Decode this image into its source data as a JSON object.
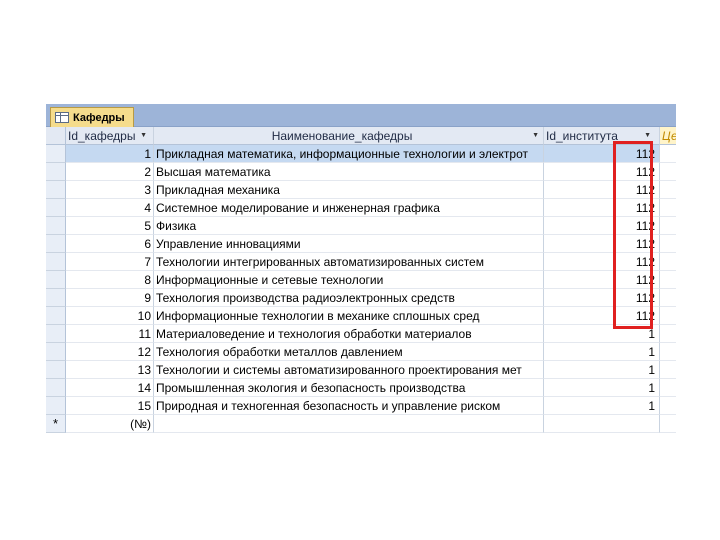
{
  "tab": {
    "label": "Кафедры",
    "icon": "table-icon"
  },
  "columns": {
    "id": "Id_кафедры",
    "name": "Наименование_кафедры",
    "inst": "Id_института",
    "extra": "Цел"
  },
  "rows": [
    {
      "id": "1",
      "name": "Прикладная математика, информационные технологии и электрот",
      "inst": "112"
    },
    {
      "id": "2",
      "name": "Высшая математика",
      "inst": "112"
    },
    {
      "id": "3",
      "name": "Прикладная механика",
      "inst": "112"
    },
    {
      "id": "4",
      "name": "Системное моделирование и инженерная графика",
      "inst": "112"
    },
    {
      "id": "5",
      "name": "Физика",
      "inst": "112"
    },
    {
      "id": "6",
      "name": "Управление инновациями",
      "inst": "112"
    },
    {
      "id": "7",
      "name": "Технологии интегрированных автоматизированных систем",
      "inst": "112"
    },
    {
      "id": "8",
      "name": "Информационные и сетевые технологии",
      "inst": "112"
    },
    {
      "id": "9",
      "name": "Технология производства радиоэлектронных средств",
      "inst": "112"
    },
    {
      "id": "10",
      "name": "Информационные технологии в механике сплошных сред",
      "inst": "112"
    },
    {
      "id": "11",
      "name": "Материаловедение и технология обработки материалов",
      "inst": "1"
    },
    {
      "id": "12",
      "name": "Технология обработки металлов давлением",
      "inst": "1"
    },
    {
      "id": "13",
      "name": "Технологии и системы автоматизированного проектирования мет",
      "inst": "1"
    },
    {
      "id": "14",
      "name": "Промышленная экология и безопасность производства",
      "inst": "1"
    },
    {
      "id": "15",
      "name": "Природная и техногенная безопасность и управление риском",
      "inst": "1"
    }
  ],
  "new_row": {
    "marker": "*",
    "id": "(№)"
  },
  "colors": {
    "highlight": "#e02020",
    "selected_row": "#c5d9f1",
    "tab": "#f5dc8c"
  }
}
